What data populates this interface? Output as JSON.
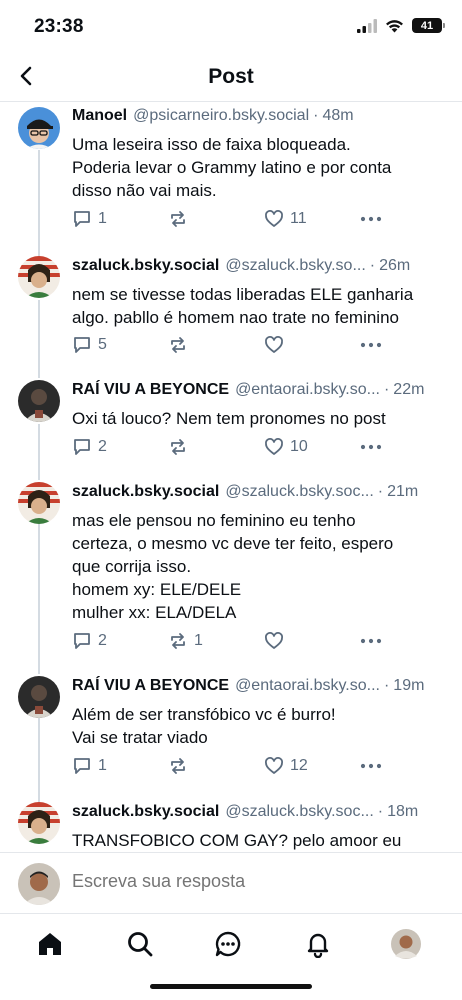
{
  "status_bar": {
    "time": "23:38",
    "battery": "41"
  },
  "header": {
    "title": "Post"
  },
  "posts": [
    {
      "author": "Manoel",
      "handle": "@psicarneiro.bsky.social",
      "time": "48m",
      "text": "Uma leseira isso de faixa bloqueada.\nPoderia levar o Grammy latino e por conta\ndisso não vai mais.",
      "replies": "1",
      "reposts": "",
      "likes": "11",
      "avatar_icon": "cap-avatar"
    },
    {
      "author": "szaluck.bsky.social",
      "handle": "@szaluck.bsky.so...",
      "time": "26m",
      "text": "nem se tivesse todas liberadas ELE ganharia\nalgo. pabllo é homem nao trate no feminino",
      "replies": "5",
      "reposts": "",
      "likes": "",
      "avatar_icon": "cartoon-avatar"
    },
    {
      "author": "RAÍ VIU A BEYONCE",
      "handle": "@entaorai.bsky.so...",
      "time": "22m",
      "text": "Oxi tá louco? Nem tem pronomes no post",
      "replies": "2",
      "reposts": "",
      "likes": "10",
      "avatar_icon": "dark-photo-avatar"
    },
    {
      "author": "szaluck.bsky.social",
      "handle": "@szaluck.bsky.soc...",
      "time": "21m",
      "text": "mas ele pensou no feminino eu tenho\ncerteza, o mesmo vc deve ter feito, espero\nque corrija isso.\nhomem xy: ELE/DELE\nmulher xx: ELA/DELA",
      "replies": "2",
      "reposts": "1",
      "likes": "",
      "avatar_icon": "cartoon-avatar"
    },
    {
      "author": "RAÍ VIU A BEYONCE",
      "handle": "@entaorai.bsky.so...",
      "time": "19m",
      "text": "Além de ser transfóbico vc é burro!\nVai se tratar viado",
      "replies": "1",
      "reposts": "",
      "likes": "12",
      "avatar_icon": "dark-photo-avatar"
    },
    {
      "author": "szaluck.bsky.social",
      "handle": "@szaluck.bsky.soc...",
      "time": "18m",
      "text": "TRANSFOBICO COM GAY? pelo amoor eu",
      "replies": "",
      "reposts": "",
      "likes": "",
      "avatar_icon": "cartoon-avatar"
    }
  ],
  "reply_bar": {
    "placeholder": "Escreva sua resposta"
  },
  "bottom_nav": [
    "home-icon",
    "search-icon",
    "chat-icon",
    "bell-icon",
    "profile-avatar"
  ],
  "colors": {
    "muted": "#5b6b7d",
    "text": "#0b0f14",
    "thread_line": "#d4dbe2",
    "divider": "#e4e7eb"
  }
}
